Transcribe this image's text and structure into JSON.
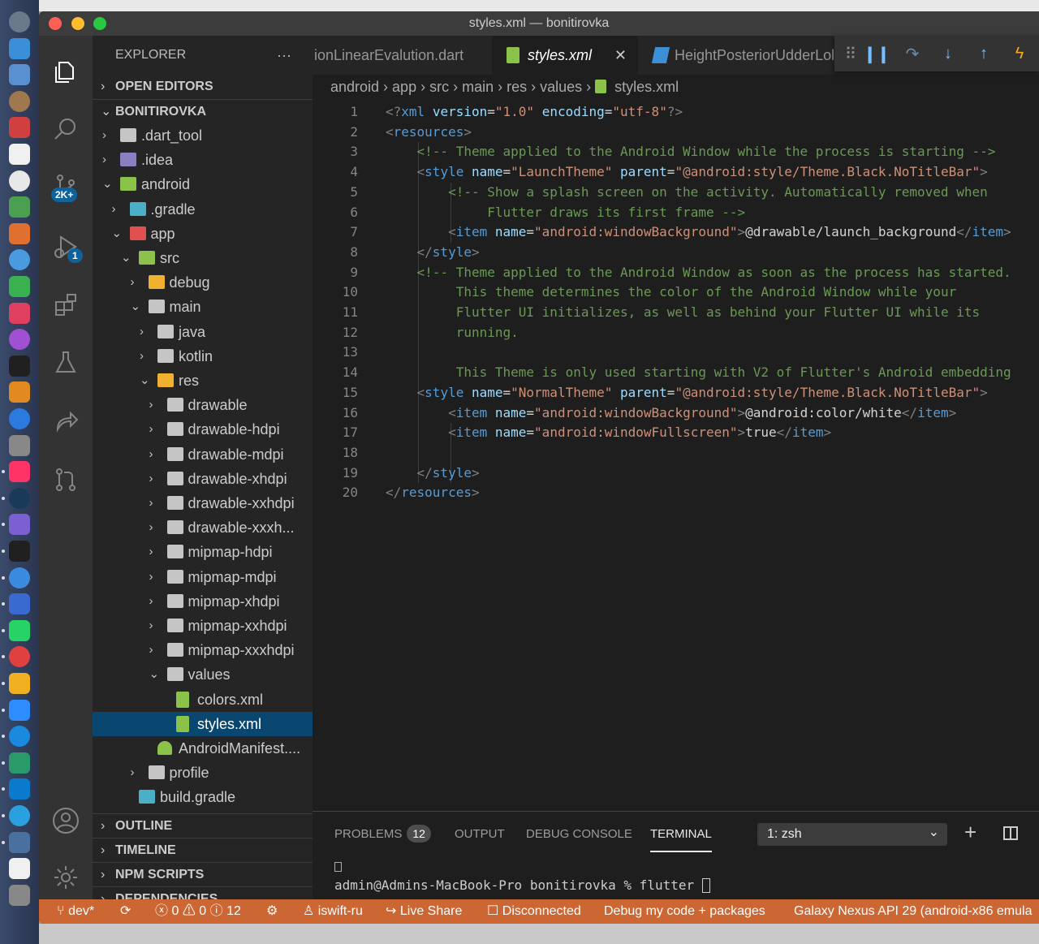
{
  "window": {
    "title": "styles.xml — bonitirovka"
  },
  "activity_bar": {
    "scm_badge": "2K+",
    "debug_badge": "1"
  },
  "sidebar": {
    "header": "EXPLORER",
    "more": "···",
    "sections": {
      "open_editors": "OPEN EDITORS",
      "project": "BONITIROVKA",
      "outline": "OUTLINE",
      "timeline": "TIMELINE",
      "npm_scripts": "NPM SCRIPTS",
      "dependencies": "DEPENDENCIES"
    },
    "tree": [
      {
        "label": ".dart_tool",
        "expanded": false
      },
      {
        "label": ".idea",
        "expanded": false
      },
      {
        "label": "android",
        "expanded": true
      },
      {
        "label": ".gradle",
        "expanded": false
      },
      {
        "label": "app",
        "expanded": true
      },
      {
        "label": "src",
        "expanded": true
      },
      {
        "label": "debug",
        "expanded": false
      },
      {
        "label": "main",
        "expanded": true
      },
      {
        "label": "java",
        "expanded": false
      },
      {
        "label": "kotlin",
        "expanded": false
      },
      {
        "label": "res",
        "expanded": true
      },
      {
        "label": "drawable",
        "expanded": false
      },
      {
        "label": "drawable-hdpi",
        "expanded": false
      },
      {
        "label": "drawable-mdpi",
        "expanded": false
      },
      {
        "label": "drawable-xhdpi",
        "expanded": false
      },
      {
        "label": "drawable-xxhdpi",
        "expanded": false
      },
      {
        "label": "drawable-xxxh...",
        "expanded": false
      },
      {
        "label": "mipmap-hdpi",
        "expanded": false
      },
      {
        "label": "mipmap-mdpi",
        "expanded": false
      },
      {
        "label": "mipmap-xhdpi",
        "expanded": false
      },
      {
        "label": "mipmap-xxhdpi",
        "expanded": false
      },
      {
        "label": "mipmap-xxxhdpi",
        "expanded": false
      },
      {
        "label": "values",
        "expanded": true
      },
      {
        "label": "colors.xml"
      },
      {
        "label": "styles.xml",
        "selected": true
      },
      {
        "label": "AndroidManifest...."
      },
      {
        "label": "profile",
        "expanded": false
      },
      {
        "label": "build.gradle"
      }
    ]
  },
  "editor": {
    "tabs": [
      {
        "label": "ionLinearEvalution.dart"
      },
      {
        "label": "styles.xml",
        "active": true,
        "close": "✕"
      },
      {
        "label": "HeightPosteriorUdderLobe"
      }
    ],
    "breadcrumb": [
      "android",
      "app",
      "src",
      "main",
      "res",
      "values",
      "styles.xml"
    ],
    "line_numbers": [
      "1",
      "2",
      "3",
      "4",
      "5",
      "6",
      "7",
      "8",
      "9",
      "10",
      "11",
      "12",
      "13",
      "14",
      "15",
      "16",
      "17",
      "18",
      "19",
      "20"
    ],
    "lines": [
      [
        [
          "pun",
          "<"
        ],
        [
          "pun",
          "?"
        ],
        [
          "tag",
          "xml "
        ],
        [
          "attr",
          "version"
        ],
        [
          "txt",
          "="
        ],
        [
          "str",
          "\"1.0\" "
        ],
        [
          "attr",
          "encoding"
        ],
        [
          "txt",
          "="
        ],
        [
          "str",
          "\"utf-8\""
        ],
        [
          "pun",
          "?>"
        ]
      ],
      [
        [
          "pun",
          "<"
        ],
        [
          "tag",
          "resources"
        ],
        [
          "pun",
          ">"
        ]
      ],
      [
        [
          "txt",
          "    "
        ],
        [
          "com",
          "<!-- Theme applied to the Android Window while the process is starting -->"
        ]
      ],
      [
        [
          "txt",
          "    "
        ],
        [
          "pun",
          "<"
        ],
        [
          "tag",
          "style "
        ],
        [
          "attr",
          "name"
        ],
        [
          "txt",
          "="
        ],
        [
          "str",
          "\"LaunchTheme\" "
        ],
        [
          "attr",
          "parent"
        ],
        [
          "txt",
          "="
        ],
        [
          "str",
          "\"@android:style/Theme.Black.NoTitleBar\""
        ],
        [
          "pun",
          ">"
        ]
      ],
      [
        [
          "txt",
          "        "
        ],
        [
          "com",
          "<!-- Show a splash screen on the activity. Automatically removed when"
        ]
      ],
      [
        [
          "txt",
          "             "
        ],
        [
          "com",
          "Flutter draws its first frame -->"
        ]
      ],
      [
        [
          "txt",
          "        "
        ],
        [
          "pun",
          "<"
        ],
        [
          "tag",
          "item "
        ],
        [
          "attr",
          "name"
        ],
        [
          "txt",
          "="
        ],
        [
          "str",
          "\"android:windowBackground\""
        ],
        [
          "pun",
          ">"
        ],
        [
          "txt",
          "@drawable/launch_background"
        ],
        [
          "pun",
          "</"
        ],
        [
          "tag",
          "item"
        ],
        [
          "pun",
          ">"
        ]
      ],
      [
        [
          "txt",
          "    "
        ],
        [
          "pun",
          "</"
        ],
        [
          "tag",
          "style"
        ],
        [
          "pun",
          ">"
        ]
      ],
      [
        [
          "txt",
          "    "
        ],
        [
          "com",
          "<!-- Theme applied to the Android Window as soon as the process has started."
        ]
      ],
      [
        [
          "txt",
          "         "
        ],
        [
          "com",
          "This theme determines the color of the Android Window while your"
        ]
      ],
      [
        [
          "txt",
          "         "
        ],
        [
          "com",
          "Flutter UI initializes, as well as behind your Flutter UI while its"
        ]
      ],
      [
        [
          "txt",
          "         "
        ],
        [
          "com",
          "running."
        ]
      ],
      [
        [
          "txt",
          ""
        ]
      ],
      [
        [
          "txt",
          "         "
        ],
        [
          "com",
          "This Theme is only used starting with V2 of Flutter's Android embedding"
        ]
      ],
      [
        [
          "txt",
          "    "
        ],
        [
          "pun",
          "<"
        ],
        [
          "tag",
          "style "
        ],
        [
          "attr",
          "name"
        ],
        [
          "txt",
          "="
        ],
        [
          "str",
          "\"NormalTheme\" "
        ],
        [
          "attr",
          "parent"
        ],
        [
          "txt",
          "="
        ],
        [
          "str",
          "\"@android:style/Theme.Black.NoTitleBar\""
        ],
        [
          "pun",
          ">"
        ]
      ],
      [
        [
          "txt",
          "        "
        ],
        [
          "pun",
          "<"
        ],
        [
          "tag",
          "item "
        ],
        [
          "attr",
          "name"
        ],
        [
          "txt",
          "="
        ],
        [
          "str",
          "\"android:windowBackground\""
        ],
        [
          "pun",
          ">"
        ],
        [
          "txt",
          "@android:color/white"
        ],
        [
          "pun",
          "</"
        ],
        [
          "tag",
          "item"
        ],
        [
          "pun",
          ">"
        ]
      ],
      [
        [
          "txt",
          "        "
        ],
        [
          "pun",
          "<"
        ],
        [
          "tag",
          "item "
        ],
        [
          "attr",
          "name"
        ],
        [
          "txt",
          "="
        ],
        [
          "str",
          "\"android:windowFullscreen\""
        ],
        [
          "pun",
          ">"
        ],
        [
          "txt",
          "true"
        ],
        [
          "pun",
          "</"
        ],
        [
          "tag",
          "item"
        ],
        [
          "pun",
          ">"
        ]
      ],
      [
        [
          "txt",
          ""
        ]
      ],
      [
        [
          "txt",
          "    "
        ],
        [
          "pun",
          "</"
        ],
        [
          "tag",
          "style"
        ],
        [
          "pun",
          ">"
        ]
      ],
      [
        [
          "pun",
          "</"
        ],
        [
          "tag",
          "resources"
        ],
        [
          "pun",
          ">"
        ]
      ]
    ]
  },
  "panel": {
    "tabs": {
      "problems": "PROBLEMS",
      "output": "OUTPUT",
      "debug_console": "DEBUG CONSOLE",
      "terminal": "TERMINAL"
    },
    "problems_count": "12",
    "terminal_select": "1: zsh",
    "terminal_lines": [
      "admin@Admins-MacBook-Pro bonitirovka % flutter "
    ]
  },
  "status_bar": {
    "branch": "dev*",
    "errors": "0",
    "warnings": "0",
    "infos": "12",
    "user": "iswift-ru",
    "live_share": "Live Share",
    "connection": "Disconnected",
    "debug_mode": "Debug my code + packages",
    "device": "Galaxy Nexus API 29 (android-x86 emula"
  },
  "colors": {
    "status_bar": "#cc6633",
    "selection": "#094771",
    "tag": "#569cd6",
    "attribute": "#9cdcfe",
    "string": "#ce9178",
    "comment": "#6a9955"
  }
}
